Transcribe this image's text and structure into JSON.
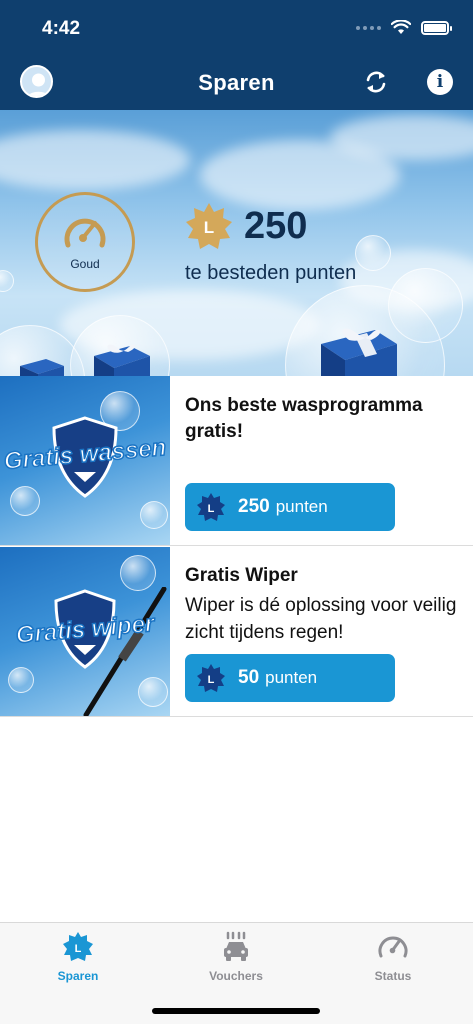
{
  "status_bar": {
    "time": "4:42"
  },
  "nav": {
    "title": "Sparen",
    "icons": [
      "avatar-icon",
      "refresh-icon",
      "info-icon"
    ],
    "info_glyph": "i"
  },
  "hero": {
    "level": {
      "name": "Goud",
      "icon": "speedometer-icon"
    },
    "points": {
      "star_letter": "L",
      "value": "250",
      "caption": "te besteden punten"
    }
  },
  "offers": [
    {
      "image_text": "Gratis wassen",
      "title": "Ons beste wasprogramma gratis!",
      "description": "",
      "badge_letter": "L",
      "points": "250",
      "unit": "punten"
    },
    {
      "image_text": "Gratis wiper",
      "title": "Gratis Wiper",
      "description": "Wiper is dé oplossing voor veilig zicht tijdens regen!",
      "badge_letter": "L",
      "points": "50",
      "unit": "punten"
    }
  ],
  "tabs": [
    {
      "label": "Sparen",
      "icon": "loyalty-star-icon",
      "active": true
    },
    {
      "label": "Vouchers",
      "icon": "car-wash-icon",
      "active": false
    },
    {
      "label": "Status",
      "icon": "speedometer-icon",
      "active": false
    }
  ],
  "colors": {
    "navy": "#0f3f6e",
    "accent": "#1a96d4",
    "gold": "#c59b52",
    "inactive": "#8e8e93"
  }
}
